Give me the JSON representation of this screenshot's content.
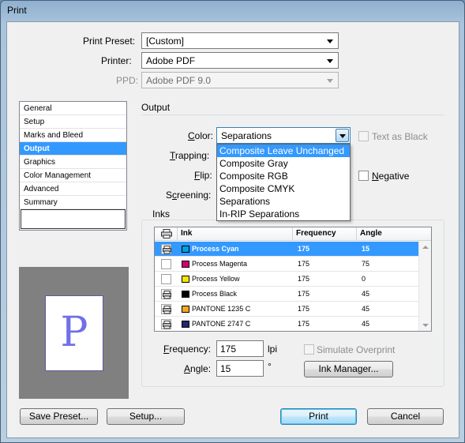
{
  "window": {
    "title": "Print"
  },
  "preset": {
    "label": "Print Preset:",
    "value": "[Custom]"
  },
  "printer": {
    "label": "Printer:",
    "value": "Adobe PDF"
  },
  "ppd": {
    "label": "PPD:",
    "value": "Adobe PDF 9.0"
  },
  "sidebar": {
    "items": [
      {
        "label": "General"
      },
      {
        "label": "Setup"
      },
      {
        "label": "Marks and Bleed"
      },
      {
        "label": "Output"
      },
      {
        "label": "Graphics"
      },
      {
        "label": "Color Management"
      },
      {
        "label": "Advanced"
      },
      {
        "label": "Summary"
      }
    ],
    "selected": "Output"
  },
  "preview": {
    "letter": "P"
  },
  "output": {
    "section_title": "Output",
    "color": {
      "label": "Color:",
      "value": "Separations"
    },
    "text_as_black": {
      "label": "Text as Black",
      "checked": false,
      "enabled": false
    },
    "trapping": {
      "label": "Trapping:"
    },
    "flip": {
      "label": "Flip:"
    },
    "negative": {
      "label": "Negative",
      "checked": false
    },
    "screening": {
      "label": "Screening:"
    }
  },
  "color_dropdown": {
    "options": [
      "Composite Leave Unchanged",
      "Composite Gray",
      "Composite RGB",
      "Composite CMYK",
      "Separations",
      "In-RIP Separations"
    ],
    "highlighted": "Composite Leave Unchanged"
  },
  "inks": {
    "group_title": "Inks",
    "columns": {
      "print": "",
      "ink": "Ink",
      "frequency": "Frequency",
      "angle": "Angle"
    },
    "rows": [
      {
        "name": "Process Cyan",
        "swatch": "#00a0e0",
        "frequency": "175",
        "angle": "15",
        "print_icon": true,
        "selected": true
      },
      {
        "name": "Process Magenta",
        "swatch": "#d0006f",
        "frequency": "175",
        "angle": "75",
        "print_icon": false,
        "selected": false
      },
      {
        "name": "Process Yellow",
        "swatch": "#f5e600",
        "frequency": "175",
        "angle": "0",
        "print_icon": false,
        "selected": false
      },
      {
        "name": "Process Black",
        "swatch": "#000000",
        "frequency": "175",
        "angle": "45",
        "print_icon": true,
        "selected": false
      },
      {
        "name": "PANTONE 1235 C",
        "swatch": "#f5a623",
        "frequency": "175",
        "angle": "45",
        "print_icon": true,
        "selected": false
      },
      {
        "name": "PANTONE 2747 C",
        "swatch": "#1f2a6b",
        "frequency": "175",
        "angle": "45",
        "print_icon": true,
        "selected": false
      }
    ]
  },
  "frequency": {
    "label": "Frequency:",
    "value": "175",
    "unit": "lpi"
  },
  "angle": {
    "label": "Angle:",
    "value": "15",
    "unit": "°"
  },
  "simulate_overprint": {
    "label": "Simulate Overprint",
    "checked": false,
    "enabled": false
  },
  "buttons": {
    "ink_manager": "Ink Manager...",
    "save_preset": "Save Preset...",
    "setup": "Setup...",
    "print": "Print",
    "cancel": "Cancel"
  }
}
